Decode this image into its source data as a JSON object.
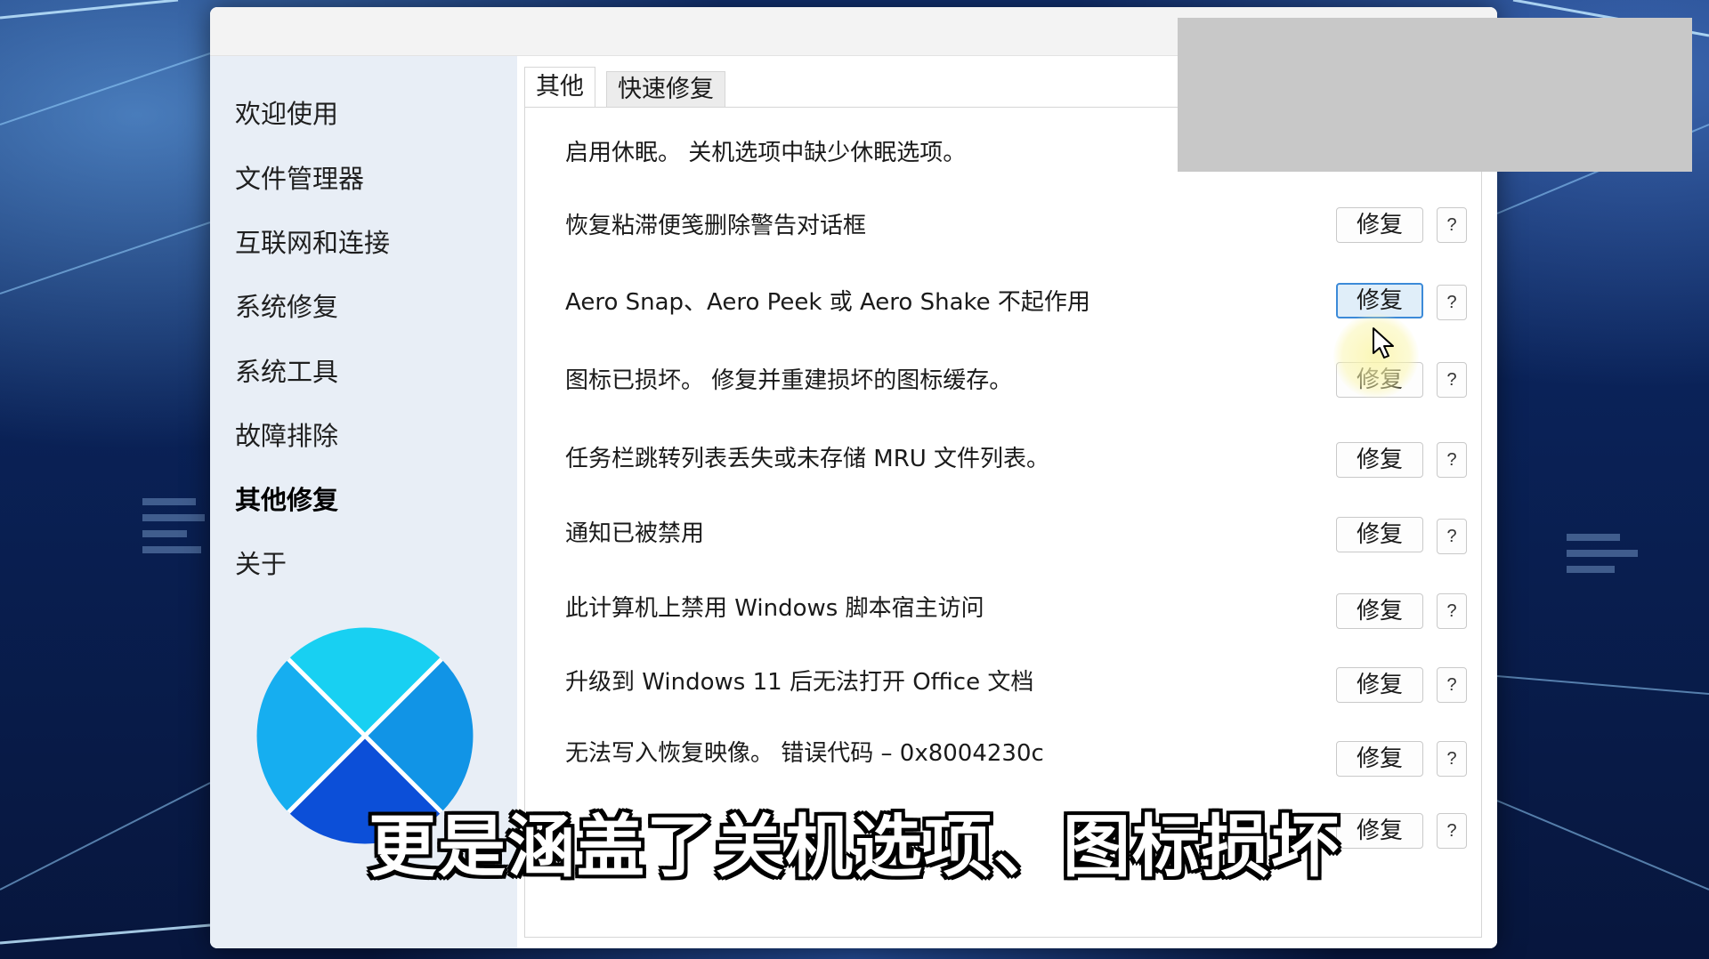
{
  "sidebar": {
    "items": [
      {
        "label": "欢迎使用"
      },
      {
        "label": "文件管理器"
      },
      {
        "label": "互联网和连接"
      },
      {
        "label": "系统修复"
      },
      {
        "label": "系统工具"
      },
      {
        "label": "故障排除"
      },
      {
        "label": "其他修复",
        "active": true
      },
      {
        "label": "关于"
      }
    ]
  },
  "tabs": [
    {
      "label": "其他",
      "active": true
    },
    {
      "label": "快速修复"
    }
  ],
  "rows": [
    {
      "label": "启用休眠。 关机选项中缺少休眠选项。"
    },
    {
      "label": "恢复粘滞便笺删除警告对话框",
      "button": "修复",
      "help": "?"
    },
    {
      "label": "Aero Snap、Aero Peek 或 Aero Shake 不起作用",
      "button": "修复",
      "help": "?",
      "hover": true
    },
    {
      "label": "图标已损坏。 修复并重建损坏的图标缓存。",
      "button": "修复",
      "help": "?"
    },
    {
      "label": "任务栏跳转列表丢失或未存储 MRU 文件列表。",
      "button": "修复",
      "help": "?"
    },
    {
      "label": "通知已被禁用",
      "button": "修复",
      "help": "?"
    },
    {
      "label": "此计算机上禁用 Windows 脚本宿主访问",
      "button": "修复",
      "help": "?"
    },
    {
      "label": "升级到 Windows 11 后无法打开 Office 文档",
      "button": "修复",
      "help": "?"
    },
    {
      "label": "无法写入恢复映像。 错误代码 – 0x8004230c",
      "button": "修复",
      "help": "?"
    },
    {
      "label": "",
      "button": "修复",
      "help": "?"
    }
  ],
  "caption": "更是涵盖了关机选项、图标损坏",
  "colors": {
    "sidebar_bg": "#e8eef6",
    "hover_button_border": "#3c8ad8",
    "logo_cyan": "#18d0f2",
    "logo_light_blue": "#16aef0",
    "logo_blue": "#1194e6",
    "logo_dark_blue": "#0c4fd8"
  },
  "icons": {
    "logo": "app-logo-circle-x",
    "cursor": "mouse-pointer-icon"
  }
}
